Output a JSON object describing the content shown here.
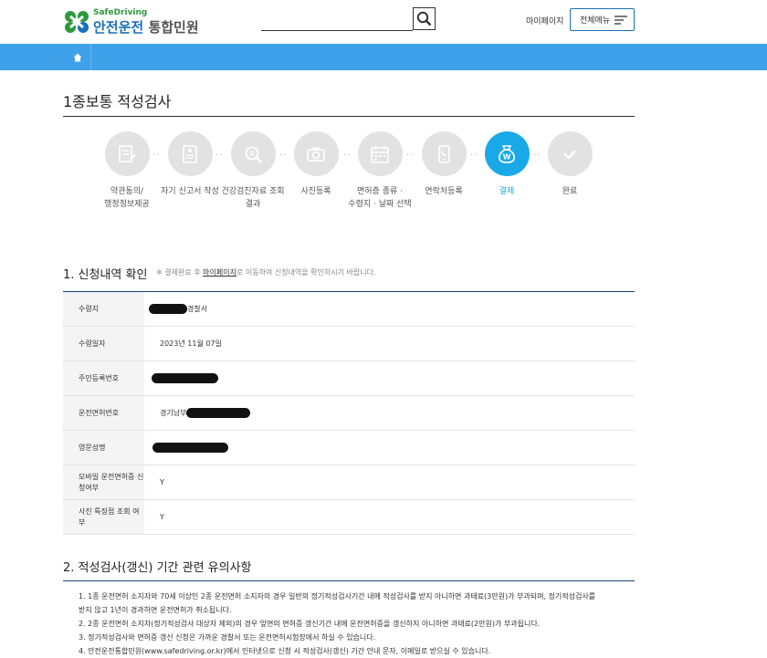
{
  "header": {
    "logo_en": "SafeDriving",
    "logo_ko_a": "안전운전",
    "logo_ko_b": "통합민원",
    "search_placeholder": "",
    "mypage": "마이페이지",
    "allmenu": "전체메뉴"
  },
  "page_title": "1종보통 적성검사",
  "steps": [
    {
      "label": "약관동의/\n행정정보제공",
      "icon": "document-edit-icon"
    },
    {
      "label": "자기 신고서 작성",
      "icon": "form-icon"
    },
    {
      "label": "건강검진자료 조회\n결과",
      "icon": "search-document-icon"
    },
    {
      "label": "사진등록",
      "icon": "camera-icon"
    },
    {
      "label": "면허증 종류 ·\n수령지 · 날짜 선택",
      "icon": "calendar-icon"
    },
    {
      "label": "연락처등록",
      "icon": "phone-icon"
    },
    {
      "label": "결제",
      "icon": "money-bag-icon"
    },
    {
      "label": "완료",
      "icon": "check-icon"
    }
  ],
  "section1": {
    "title": "1. 신청내역 확인",
    "note_prefix": "※ 결제완료 후 ",
    "note_link": "마이페이지",
    "note_suffix": "로 이동하여 신청내역을 확인하시기 바랍니다."
  },
  "table": {
    "rows": [
      {
        "label": "수령지",
        "value": "경찰서"
      },
      {
        "label": "수령일자",
        "value": "2023년 11월 07일"
      },
      {
        "label": "주민등록번호",
        "value": ""
      },
      {
        "label": "운전면허번호",
        "value": "경기남부"
      },
      {
        "label": "영문성명",
        "value": ""
      },
      {
        "label": "모바일 운전면허증 신청여부",
        "value": "Y"
      },
      {
        "label": "사진 특징점 조회 여부",
        "value": "Y"
      }
    ]
  },
  "section2": {
    "title": "2. 적성검사(갱신) 기간 관련 유의사항",
    "notes": [
      "1. 1종 운전면허 소지자와 70세 이상인 2종 운전면허 소지자의 경우 일반의 정기적성검사기간 내에 적성검사를 받지 아니하면 과태료(3만원)가 부과되며, 정기적성검사를",
      "받지 않고 1년이 경과하면 운전면허가 취소됩니다.",
      "2. 2종 운전면허 소지자(정기적성검사 대상자 제외)의 경우 앞면의 면허증 갱신기간 내에 운전면허증을 갱신하지 아니하면 과태료(2만원)가 부과됩니다.",
      "3. 정기적성검사와 면허증 갱신 신청은 가까운 경찰서 또는 운전면허시험장에서 하실 수 있습니다.",
      "4. 안전운전통합민원(www.safedriving.or.kr)에서 인터넷으로 신청 시 적성검사(갱신) 기간 안내 문자, 이메일로 받으실 수 있습니다."
    ]
  },
  "colors": {
    "brand_blue": "#1a6fb8",
    "nav_blue": "#3ea1ea",
    "active_step": "#19a9e8",
    "logo_green": "#2c9a3c"
  }
}
